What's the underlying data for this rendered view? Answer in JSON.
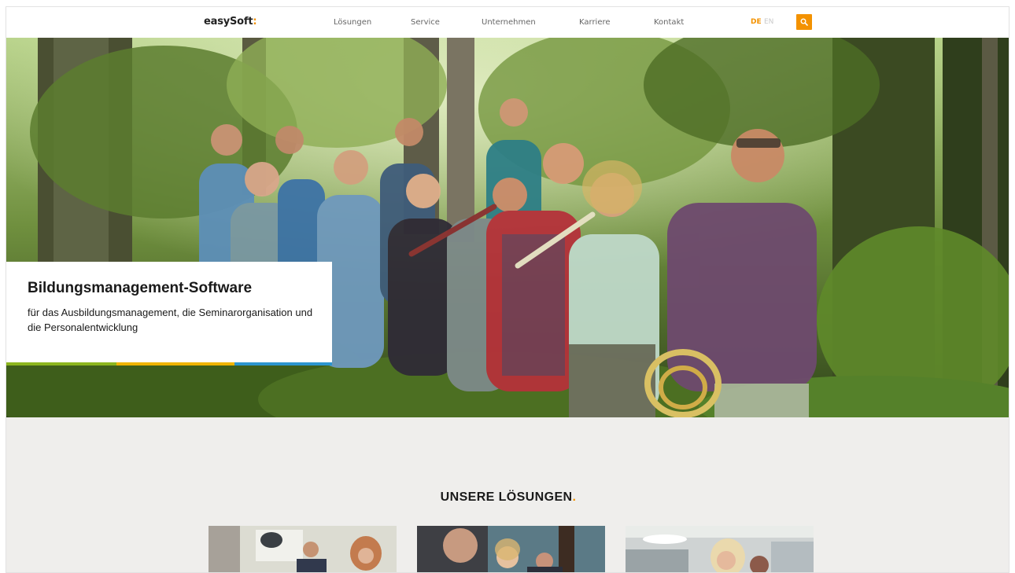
{
  "header": {
    "logo": "easySoft",
    "logo_mark": ":",
    "nav": [
      "Lösungen",
      "Service",
      "Unternehmen",
      "Karriere",
      "Kontakt"
    ],
    "lang_active": "DE",
    "lang_other": "EN",
    "search_icon": "search-icon"
  },
  "hero": {
    "title": "Bildungsmanagement-Software",
    "subtitle": "für das Ausbildungsmanagement, die Seminarorganisation und die Personalentwicklung",
    "accent_colors": [
      "#8cb51e",
      "#f0b400",
      "#2c95cf"
    ]
  },
  "solutions": {
    "heading": "UNSERE LÖSUNGEN",
    "heading_dot": ".",
    "cards": [
      "card-1",
      "card-2",
      "card-3"
    ]
  },
  "colors": {
    "accent": "#f39200",
    "page_bg": "#efeeec"
  }
}
